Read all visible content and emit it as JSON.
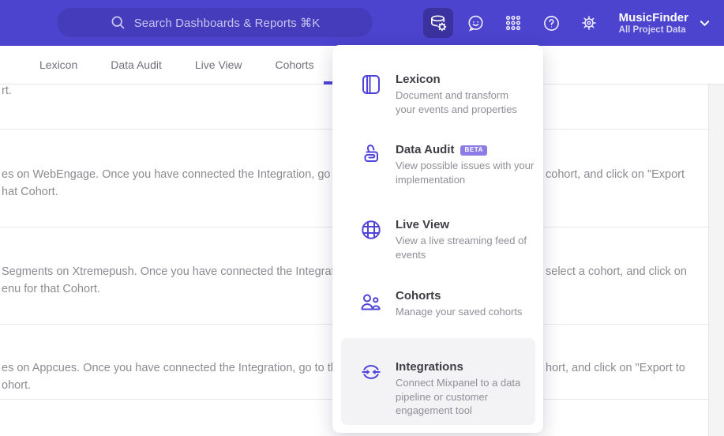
{
  "colors": {
    "header_bg": "#4c43ce",
    "search_bg": "#453cbb",
    "accent_purple": "#4f44d9",
    "beta_badge_bg": "#8d7ce6",
    "highlight_bg": "#f3f3f5",
    "body_text": "#8b8b92"
  },
  "header": {
    "search_placeholder": "Search Dashboards & Reports ⌘K",
    "project_name": "MusicFinder",
    "project_scope": "All Project Data"
  },
  "nav": {
    "tabs": [
      "Lexicon",
      "Data Audit",
      "Live View",
      "Cohorts"
    ]
  },
  "background_rows": {
    "row0_left": "rt.",
    "row1_left1": "es on WebEngage. Once you have connected the Integration, go to the",
    "row1_left2": "hat Cohort.",
    "row1_right": "cohort, and click on \"Export",
    "row2_left1": "Segments on Xtremepush. Once you have connected the Integration,",
    "row2_left2": "enu for that Cohort.",
    "row2_right": "select a cohort, and click on",
    "row3_left1": "es on Appcues. Once you have connected the Integration, go to the M",
    "row3_left2": "ohort.",
    "row3_right": "hort, and click on \"Export to"
  },
  "menu": {
    "items": [
      {
        "title": "Lexicon",
        "desc": "Document and transform\nyour events and properties"
      },
      {
        "title": "Data Audit",
        "badge": "BETA",
        "desc": "View possible issues with your\nimplementation"
      },
      {
        "title": "Live View",
        "desc": "View a live streaming feed of\nevents"
      },
      {
        "title": "Cohorts",
        "desc": "Manage your saved cohorts"
      },
      {
        "title": "Integrations",
        "desc": "Connect Mixpanel to a data\npipeline or customer\nengagement tool"
      }
    ]
  }
}
